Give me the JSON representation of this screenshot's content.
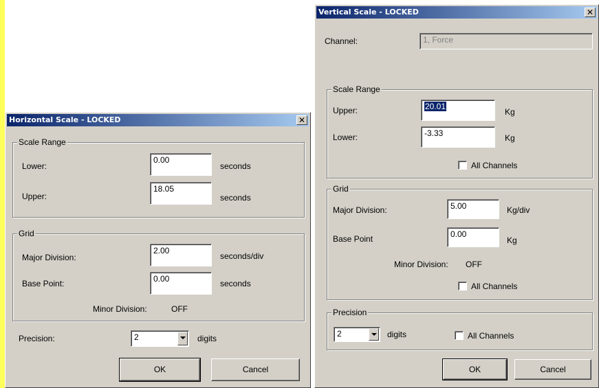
{
  "horizontal": {
    "title": "Horizontal Scale - LOCKED",
    "scale_range": {
      "title": "Scale Range",
      "lower_label": "Lower:",
      "lower_value": "0.00",
      "lower_unit": "seconds",
      "upper_label": "Upper:",
      "upper_value": "18.05",
      "upper_unit": "seconds"
    },
    "grid": {
      "title": "Grid",
      "major_label": "Major Division:",
      "major_value": "2.00",
      "major_unit": "seconds/div",
      "base_label": "Base Point:",
      "base_value": "0.00",
      "base_unit": "seconds",
      "minor_label": "Minor Division:",
      "minor_value": "OFF"
    },
    "precision": {
      "label": "Precision:",
      "value": "2",
      "unit": "digits"
    },
    "ok_label": "OK",
    "cancel_label": "Cancel"
  },
  "vertical": {
    "title": "Vertical Scale - LOCKED",
    "channel_label": "Channel:",
    "channel_value": "1, Force",
    "scale_range": {
      "title": "Scale Range",
      "upper_label": "Upper:",
      "upper_value": "20.01",
      "upper_unit": "Kg",
      "lower_label": "Lower:",
      "lower_value": "-3.33",
      "lower_unit": "Kg",
      "all_channels_label": "All Channels"
    },
    "grid": {
      "title": "Grid",
      "major_label": "Major Division:",
      "major_value": "5.00",
      "major_unit": "Kg/div",
      "base_label": "Base Point",
      "base_value": "0.00",
      "base_unit": "Kg",
      "minor_label": "Minor Division:",
      "minor_value": "OFF",
      "all_channels_label": "All Channels"
    },
    "precision": {
      "title": "Precision",
      "value": "2",
      "unit": "digits",
      "all_channels_label": "All Channels"
    },
    "ok_label": "OK",
    "cancel_label": "Cancel"
  },
  "icons": {
    "close": "close-icon",
    "dropdown": "chevron-down-icon"
  }
}
